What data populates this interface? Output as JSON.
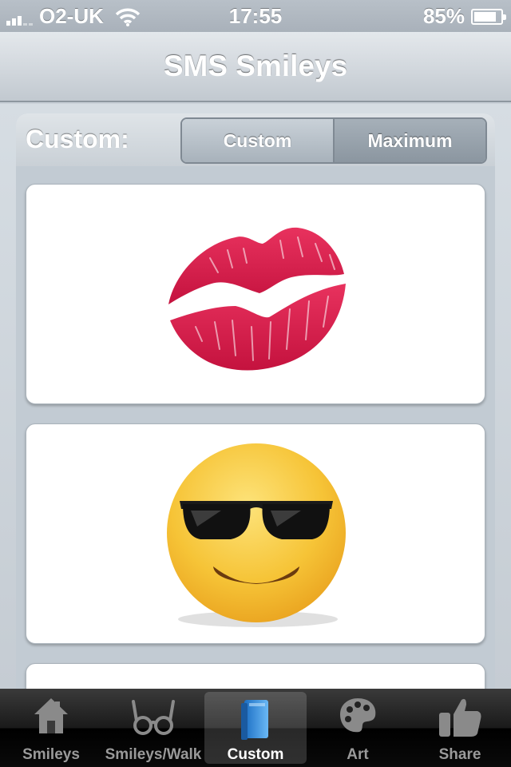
{
  "status_bar": {
    "carrier": "O2-UK",
    "time": "17:55",
    "battery": "85%",
    "battery_level": 0.85
  },
  "nav": {
    "title": "SMS Smileys"
  },
  "panel": {
    "label": "Custom:",
    "segments": [
      "Custom",
      "Maximum"
    ],
    "selected_segment": 0
  },
  "cards": [
    {
      "emoji": "kiss-mark"
    },
    {
      "emoji": "smiling-face-with-sunglasses"
    },
    {
      "emoji": "partially-visible"
    }
  ],
  "tabs": [
    {
      "label": "Smileys",
      "icon": "home-icon"
    },
    {
      "label": "Smileys/Walk",
      "icon": "glasses-icon"
    },
    {
      "label": "Custom",
      "icon": "book-icon",
      "selected": true
    },
    {
      "label": "Art",
      "icon": "palette-icon"
    },
    {
      "label": "Share",
      "icon": "thumbs-up-icon"
    }
  ],
  "colors": {
    "tab_selected_icon": "#3c9be8",
    "lips": "#d81e4e",
    "smiley": "#f6c437"
  }
}
